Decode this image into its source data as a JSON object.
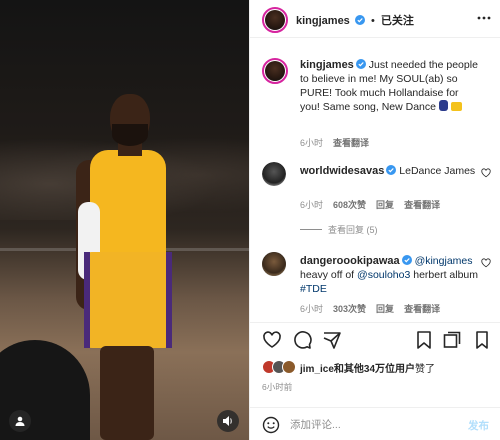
{
  "post": {
    "media_alt": "Photo of a basketball player in a gold jersey on court",
    "author": "kingjames",
    "follow_status": "已关注",
    "caption": "Just needed the people to believe in me! My SOUL(ab) so PURE! Took much Hollandaise for you! Same song, New Dance",
    "caption_time": "6小时",
    "see_translation": "查看翻译"
  },
  "comments": [
    {
      "username": "worldwidesavas",
      "text": "LeDance James",
      "time": "6小时",
      "likes": "608次赞",
      "reply": "回复",
      "translate": "查看翻译",
      "view_replies": "查看回复 (5)"
    },
    {
      "username": "dangeroookipawaa",
      "mention1": "@kingjames",
      "text_a": "heavy off of",
      "mention2": "@souloho3",
      "text_b": "herbert album",
      "hashtag": "#TDE",
      "time": "6小时",
      "likes": "303次赞",
      "reply": "回复",
      "translate": "查看翻译"
    }
  ],
  "likes": {
    "first_liker": "jim_ice",
    "rest": "和其他34万位用户",
    "suffix": "赞了"
  },
  "post_time": "6小时前",
  "composer": {
    "placeholder": "添加评论...",
    "post_label": "发布"
  },
  "icons": {
    "more": "more-horizontal-icon",
    "like": "heart-icon",
    "comment": "comment-icon",
    "share": "send-icon",
    "save": "bookmark-icon",
    "emoji": "emoji-icon",
    "sound": "sound-icon",
    "tag": "user-tag-icon"
  },
  "colors": {
    "verified": "#3897f0",
    "link": "#00376b",
    "post_button": "#b2dffc"
  }
}
